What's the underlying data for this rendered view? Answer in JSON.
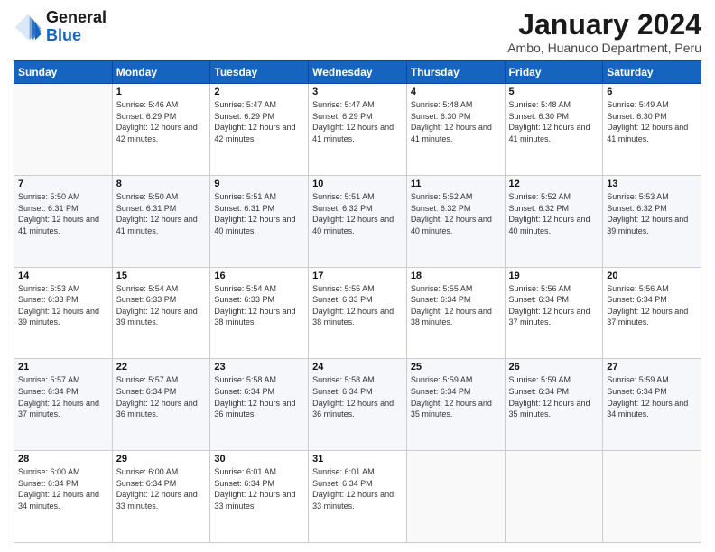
{
  "logo": {
    "line1": "General",
    "line2": "Blue"
  },
  "title": "January 2024",
  "subtitle": "Ambo, Huanuco Department, Peru",
  "days_header": [
    "Sunday",
    "Monday",
    "Tuesday",
    "Wednesday",
    "Thursday",
    "Friday",
    "Saturday"
  ],
  "weeks": [
    [
      {
        "num": "",
        "sunrise": "",
        "sunset": "",
        "daylight": ""
      },
      {
        "num": "1",
        "sunrise": "Sunrise: 5:46 AM",
        "sunset": "Sunset: 6:29 PM",
        "daylight": "Daylight: 12 hours and 42 minutes."
      },
      {
        "num": "2",
        "sunrise": "Sunrise: 5:47 AM",
        "sunset": "Sunset: 6:29 PM",
        "daylight": "Daylight: 12 hours and 42 minutes."
      },
      {
        "num": "3",
        "sunrise": "Sunrise: 5:47 AM",
        "sunset": "Sunset: 6:29 PM",
        "daylight": "Daylight: 12 hours and 41 minutes."
      },
      {
        "num": "4",
        "sunrise": "Sunrise: 5:48 AM",
        "sunset": "Sunset: 6:30 PM",
        "daylight": "Daylight: 12 hours and 41 minutes."
      },
      {
        "num": "5",
        "sunrise": "Sunrise: 5:48 AM",
        "sunset": "Sunset: 6:30 PM",
        "daylight": "Daylight: 12 hours and 41 minutes."
      },
      {
        "num": "6",
        "sunrise": "Sunrise: 5:49 AM",
        "sunset": "Sunset: 6:30 PM",
        "daylight": "Daylight: 12 hours and 41 minutes."
      }
    ],
    [
      {
        "num": "7",
        "sunrise": "Sunrise: 5:50 AM",
        "sunset": "Sunset: 6:31 PM",
        "daylight": "Daylight: 12 hours and 41 minutes."
      },
      {
        "num": "8",
        "sunrise": "Sunrise: 5:50 AM",
        "sunset": "Sunset: 6:31 PM",
        "daylight": "Daylight: 12 hours and 41 minutes."
      },
      {
        "num": "9",
        "sunrise": "Sunrise: 5:51 AM",
        "sunset": "Sunset: 6:31 PM",
        "daylight": "Daylight: 12 hours and 40 minutes."
      },
      {
        "num": "10",
        "sunrise": "Sunrise: 5:51 AM",
        "sunset": "Sunset: 6:32 PM",
        "daylight": "Daylight: 12 hours and 40 minutes."
      },
      {
        "num": "11",
        "sunrise": "Sunrise: 5:52 AM",
        "sunset": "Sunset: 6:32 PM",
        "daylight": "Daylight: 12 hours and 40 minutes."
      },
      {
        "num": "12",
        "sunrise": "Sunrise: 5:52 AM",
        "sunset": "Sunset: 6:32 PM",
        "daylight": "Daylight: 12 hours and 40 minutes."
      },
      {
        "num": "13",
        "sunrise": "Sunrise: 5:53 AM",
        "sunset": "Sunset: 6:32 PM",
        "daylight": "Daylight: 12 hours and 39 minutes."
      }
    ],
    [
      {
        "num": "14",
        "sunrise": "Sunrise: 5:53 AM",
        "sunset": "Sunset: 6:33 PM",
        "daylight": "Daylight: 12 hours and 39 minutes."
      },
      {
        "num": "15",
        "sunrise": "Sunrise: 5:54 AM",
        "sunset": "Sunset: 6:33 PM",
        "daylight": "Daylight: 12 hours and 39 minutes."
      },
      {
        "num": "16",
        "sunrise": "Sunrise: 5:54 AM",
        "sunset": "Sunset: 6:33 PM",
        "daylight": "Daylight: 12 hours and 38 minutes."
      },
      {
        "num": "17",
        "sunrise": "Sunrise: 5:55 AM",
        "sunset": "Sunset: 6:33 PM",
        "daylight": "Daylight: 12 hours and 38 minutes."
      },
      {
        "num": "18",
        "sunrise": "Sunrise: 5:55 AM",
        "sunset": "Sunset: 6:34 PM",
        "daylight": "Daylight: 12 hours and 38 minutes."
      },
      {
        "num": "19",
        "sunrise": "Sunrise: 5:56 AM",
        "sunset": "Sunset: 6:34 PM",
        "daylight": "Daylight: 12 hours and 37 minutes."
      },
      {
        "num": "20",
        "sunrise": "Sunrise: 5:56 AM",
        "sunset": "Sunset: 6:34 PM",
        "daylight": "Daylight: 12 hours and 37 minutes."
      }
    ],
    [
      {
        "num": "21",
        "sunrise": "Sunrise: 5:57 AM",
        "sunset": "Sunset: 6:34 PM",
        "daylight": "Daylight: 12 hours and 37 minutes."
      },
      {
        "num": "22",
        "sunrise": "Sunrise: 5:57 AM",
        "sunset": "Sunset: 6:34 PM",
        "daylight": "Daylight: 12 hours and 36 minutes."
      },
      {
        "num": "23",
        "sunrise": "Sunrise: 5:58 AM",
        "sunset": "Sunset: 6:34 PM",
        "daylight": "Daylight: 12 hours and 36 minutes."
      },
      {
        "num": "24",
        "sunrise": "Sunrise: 5:58 AM",
        "sunset": "Sunset: 6:34 PM",
        "daylight": "Daylight: 12 hours and 36 minutes."
      },
      {
        "num": "25",
        "sunrise": "Sunrise: 5:59 AM",
        "sunset": "Sunset: 6:34 PM",
        "daylight": "Daylight: 12 hours and 35 minutes."
      },
      {
        "num": "26",
        "sunrise": "Sunrise: 5:59 AM",
        "sunset": "Sunset: 6:34 PM",
        "daylight": "Daylight: 12 hours and 35 minutes."
      },
      {
        "num": "27",
        "sunrise": "Sunrise: 5:59 AM",
        "sunset": "Sunset: 6:34 PM",
        "daylight": "Daylight: 12 hours and 34 minutes."
      }
    ],
    [
      {
        "num": "28",
        "sunrise": "Sunrise: 6:00 AM",
        "sunset": "Sunset: 6:34 PM",
        "daylight": "Daylight: 12 hours and 34 minutes."
      },
      {
        "num": "29",
        "sunrise": "Sunrise: 6:00 AM",
        "sunset": "Sunset: 6:34 PM",
        "daylight": "Daylight: 12 hours and 33 minutes."
      },
      {
        "num": "30",
        "sunrise": "Sunrise: 6:01 AM",
        "sunset": "Sunset: 6:34 PM",
        "daylight": "Daylight: 12 hours and 33 minutes."
      },
      {
        "num": "31",
        "sunrise": "Sunrise: 6:01 AM",
        "sunset": "Sunset: 6:34 PM",
        "daylight": "Daylight: 12 hours and 33 minutes."
      },
      {
        "num": "",
        "sunrise": "",
        "sunset": "",
        "daylight": ""
      },
      {
        "num": "",
        "sunrise": "",
        "sunset": "",
        "daylight": ""
      },
      {
        "num": "",
        "sunrise": "",
        "sunset": "",
        "daylight": ""
      }
    ]
  ]
}
